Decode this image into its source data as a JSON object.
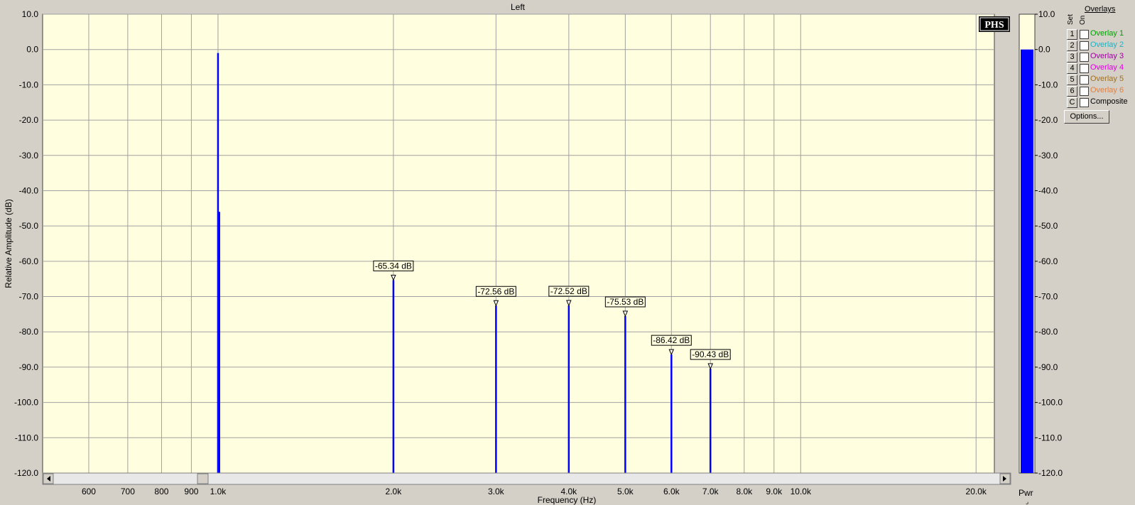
{
  "window": {
    "title": "Left"
  },
  "logo": "PHS",
  "overlays_panel": {
    "title": "Overlays",
    "set_header": "Set",
    "on_header": "On",
    "items": [
      {
        "set": "1",
        "label": "Overlay 1",
        "color": "#00a000"
      },
      {
        "set": "2",
        "label": "Overlay 2",
        "color": "#20b0c0"
      },
      {
        "set": "3",
        "label": "Overlay 3",
        "color": "#a000a0"
      },
      {
        "set": "4",
        "label": "Overlay 4",
        "color": "#e000e0"
      },
      {
        "set": "5",
        "label": "Overlay 5",
        "color": "#a07020"
      },
      {
        "set": "6",
        "label": "Overlay 6",
        "color": "#e08040"
      },
      {
        "set": "C",
        "label": "Composite",
        "color": "#000000"
      }
    ],
    "options_label": "Options..."
  },
  "power_meter": {
    "label": "Pwr",
    "level_db": 0.0,
    "color": "#0000ff"
  },
  "colors": {
    "plot_bg": "#ffffe0",
    "trace": "#0000ff",
    "grid": "#a0a0a0",
    "window_bg": "#d4d0c8"
  },
  "chart_data": {
    "type": "line",
    "title": "Left",
    "xlabel": "Frequency (Hz)",
    "ylabel": "Relative Amplitude (dB)",
    "x_scale": "log",
    "xlim": [
      500,
      21500
    ],
    "ylim": [
      -120,
      10
    ],
    "grid": true,
    "y_ticks": [
      "10.0",
      "0.0",
      "-10.0",
      "-20.0",
      "-30.0",
      "-40.0",
      "-50.0",
      "-60.0",
      "-70.0",
      "-80.0",
      "-90.0",
      "-100.0",
      "-110.0",
      "-120.0"
    ],
    "y_tick_values": [
      10,
      0,
      -10,
      -20,
      -30,
      -40,
      -50,
      -60,
      -70,
      -80,
      -90,
      -100,
      -110,
      -120
    ],
    "x_ticks": [
      {
        "value": 600,
        "label": "600"
      },
      {
        "value": 700,
        "label": "700"
      },
      {
        "value": 800,
        "label": "800"
      },
      {
        "value": 900,
        "label": "900"
      },
      {
        "value": 1000,
        "label": "1.0k"
      },
      {
        "value": 2000,
        "label": "2.0k"
      },
      {
        "value": 3000,
        "label": "3.0k"
      },
      {
        "value": 4000,
        "label": "4.0k"
      },
      {
        "value": 5000,
        "label": "5.0k"
      },
      {
        "value": 6000,
        "label": "6.0k"
      },
      {
        "value": 7000,
        "label": "7.0k"
      },
      {
        "value": 8000,
        "label": "8.0k"
      },
      {
        "value": 9000,
        "label": "9.0k"
      },
      {
        "value": 10000,
        "label": "10.0k"
      },
      {
        "value": 20000,
        "label": "20.0k"
      }
    ],
    "series": [
      {
        "peaks": [
          {
            "x": 1000,
            "y": -1.0
          },
          {
            "x": 1005,
            "y": -46.0
          },
          {
            "x": 2000,
            "y": -65.34
          },
          {
            "x": 3000,
            "y": -72.56
          },
          {
            "x": 4000,
            "y": -72.52
          },
          {
            "x": 5000,
            "y": -75.53
          },
          {
            "x": 6000,
            "y": -86.42
          },
          {
            "x": 7000,
            "y": -90.43
          }
        ]
      }
    ],
    "annotations": [
      {
        "x": 2000,
        "y": -65.34,
        "text": "-65.34 dB"
      },
      {
        "x": 3000,
        "y": -72.56,
        "text": "-72.56 dB"
      },
      {
        "x": 4000,
        "y": -72.52,
        "text": "-72.52 dB"
      },
      {
        "x": 5000,
        "y": -75.53,
        "text": "-75.53 dB"
      },
      {
        "x": 6000,
        "y": -86.42,
        "text": "-86.42 dB"
      },
      {
        "x": 7000,
        "y": -90.43,
        "text": "-90.43 dB"
      }
    ]
  }
}
